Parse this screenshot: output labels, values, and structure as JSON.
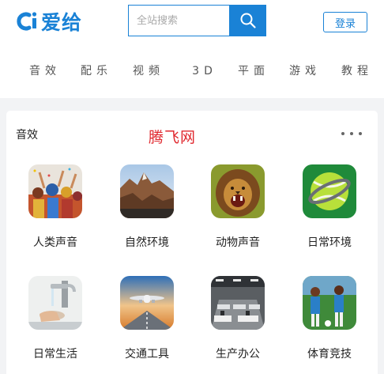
{
  "header": {
    "logo_text": "爱给",
    "search_placeholder": "全站搜索",
    "login_label": "登录"
  },
  "nav": {
    "items": [
      "音效",
      "配乐",
      "视频",
      "3D",
      "平面",
      "游戏",
      "教程"
    ]
  },
  "section": {
    "title": "音效",
    "watermark": "腾飞网",
    "categories": [
      {
        "label": "人类声音",
        "icon": "crowd-icon"
      },
      {
        "label": "自然环境",
        "icon": "mountain-icon"
      },
      {
        "label": "动物声音",
        "icon": "lion-icon"
      },
      {
        "label": "日常环境",
        "icon": "tennis-ball-icon"
      },
      {
        "label": "日常生活",
        "icon": "faucet-icon"
      },
      {
        "label": "交通工具",
        "icon": "airplane-icon"
      },
      {
        "label": "生产办公",
        "icon": "office-icon"
      },
      {
        "label": "体育竞技",
        "icon": "soccer-icon"
      }
    ]
  },
  "colors": {
    "brand": "#1a82d6",
    "watermark": "#e0282e",
    "background": "#f2f3f5"
  }
}
